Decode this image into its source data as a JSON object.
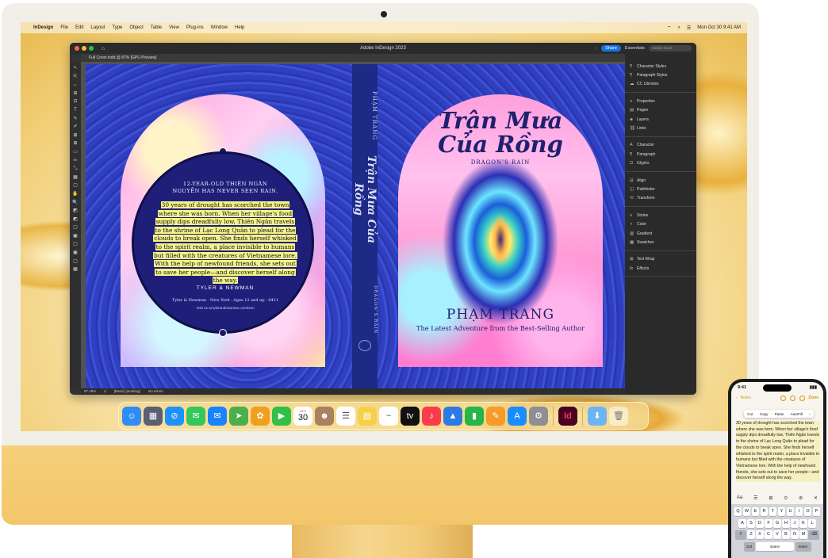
{
  "menubar": {
    "app": "InDesign",
    "items": [
      "File",
      "Edit",
      "Layout",
      "Type",
      "Object",
      "Table",
      "View",
      "Plug-ins",
      "Window",
      "Help"
    ],
    "clock": "Mon Oct 30  9:41 AM"
  },
  "window": {
    "title": "Adobe InDesign 2023",
    "share_label": "Share",
    "workspace_label": "Essentials",
    "search_placeholder": "Adobe Stock",
    "doc_tab": "Full Cover.indd @ 87% [GPU Preview]"
  },
  "tools": [
    "↖",
    "⇱",
    "↔",
    "⊞",
    "⊡",
    "T",
    "✎",
    "✐",
    "⊠",
    "⊠",
    "▭",
    "✂",
    "⤡",
    "▦",
    "▢",
    "✋",
    "🔍",
    "◩",
    "◩",
    "▢",
    "▣",
    "▢",
    "▣",
    "▢",
    "▦"
  ],
  "panels": {
    "groups": [
      [
        {
          "icon": "¶",
          "label": "Character Styles"
        },
        {
          "icon": "¶",
          "label": "Paragraph Styles"
        },
        {
          "icon": "☁",
          "label": "CC Libraries"
        }
      ],
      [
        {
          "icon": "≡",
          "label": "Properties"
        },
        {
          "icon": "▤",
          "label": "Pages"
        },
        {
          "icon": "◈",
          "label": "Layers"
        },
        {
          "icon": "⛓",
          "label": "Links"
        }
      ],
      [
        {
          "icon": "A",
          "label": "Character"
        },
        {
          "icon": "¶",
          "label": "Paragraph"
        },
        {
          "icon": "Ω",
          "label": "Glyphs"
        }
      ],
      [
        {
          "icon": "⊟",
          "label": "Align"
        },
        {
          "icon": "◫",
          "label": "Pathfinder"
        },
        {
          "icon": "⟲",
          "label": "Transform"
        }
      ],
      [
        {
          "icon": "≡",
          "label": "Stroke"
        },
        {
          "icon": "◑",
          "label": "Color"
        },
        {
          "icon": "▥",
          "label": "Gradient"
        },
        {
          "icon": "▦",
          "label": "Swatches"
        }
      ],
      [
        {
          "icon": "⊞",
          "label": "Text Wrap"
        },
        {
          "icon": "fx",
          "label": "Effects"
        }
      ]
    ]
  },
  "status": {
    "zoom": "87.19%",
    "page": "2",
    "style": "[Basic] (working)",
    "errors": "No errors"
  },
  "cover": {
    "back": {
      "tagline": "12-YEAR-OLD THIÊN NGÂN NGUYỄN HAS NEVER SEEN RAIN.",
      "blurb": "30 years of drought has scorched the town where she was born. When her village's food supply dips dreadfully low, Thiên Ngân travels to the shrine of Lạc Long Quân to plead for the clouds to break open. She finds herself whisked to the spirit realm, a place invisible to humans but filled with the creatures of Vietnamese lore. With the help of newfound friends, she sets out to save her people—and discover herself along the way.",
      "publisher_logo": "TYLER & NEWMAN",
      "publisher_line": "Tyler & Newman · New York · Ages 12 and up · 0411",
      "publisher_url": "Visit us at tylerandnewman.com/tson"
    },
    "spine": {
      "author": "PHẠM TRANG",
      "title": "Trận Mưa Của Rồng",
      "subtitle": "DRAGON'S RAIN"
    },
    "front": {
      "title_line1": "Trận Mưa",
      "title_line2": "Của Rồng",
      "subtitle": "DRAGON'S RAIN",
      "author": "PHẠM TRANG",
      "tagline": "The Latest Adventure from the Best-Selling Author"
    }
  },
  "dock": {
    "apps": [
      {
        "name": "finder",
        "glyph": "☺",
        "color": "#2f8cf5"
      },
      {
        "name": "launchpad",
        "glyph": "▦",
        "color": "#5b5f73"
      },
      {
        "name": "safari",
        "glyph": "⊘",
        "color": "#1e90ff"
      },
      {
        "name": "messages",
        "glyph": "✉",
        "color": "#34c759"
      },
      {
        "name": "mail",
        "glyph": "✉",
        "color": "#1a82fb"
      },
      {
        "name": "maps",
        "glyph": "➤",
        "color": "#4cae4c"
      },
      {
        "name": "photos",
        "glyph": "✿",
        "color": "#f0a020"
      },
      {
        "name": "facetime",
        "glyph": "▶",
        "color": "#30c04a"
      },
      {
        "name": "calendar",
        "glyph": "30",
        "color": "#ffffff"
      },
      {
        "name": "contacts",
        "glyph": "☻",
        "color": "#a98160"
      },
      {
        "name": "reminders",
        "glyph": "☰",
        "color": "#ffffff"
      },
      {
        "name": "notes",
        "glyph": "▤",
        "color": "#f6d04d"
      },
      {
        "name": "freeform",
        "glyph": "~",
        "color": "#ffffff"
      },
      {
        "name": "tv",
        "glyph": "tv",
        "color": "#111111"
      },
      {
        "name": "music",
        "glyph": "♪",
        "color": "#fa3c4c"
      },
      {
        "name": "keynote",
        "glyph": "▲",
        "color": "#2c7be5"
      },
      {
        "name": "numbers",
        "glyph": "▮",
        "color": "#28b446"
      },
      {
        "name": "pages",
        "glyph": "✎",
        "color": "#f59b2a"
      },
      {
        "name": "app-store",
        "glyph": "A",
        "color": "#1a8cff"
      },
      {
        "name": "system-settings",
        "glyph": "⚙",
        "color": "#8e8e93"
      }
    ],
    "calendar_month": "OCT",
    "calendar_day": "30",
    "indesign": "Id",
    "downloads_glyph": "⬇",
    "trash_glyph": "🗑"
  },
  "phone": {
    "time": "9:41",
    "back_label": "Notes",
    "done_label": "Done",
    "edit_menu": [
      "Cut",
      "Copy",
      "Paste",
      "AutoFill",
      "›"
    ],
    "note_text": "30 years of drought has scorched the town where she was born. When her village's food supply dips dreadfully low, Thiên Ngân travels to the shrine of Lạc Long Quân to plead for the clouds to break open. She finds herself whisked to the spirit realm, a place invisible to humans but filled with the creatures of Vietnamese lore. With the help of newfound friends, she sets out to save her people—and discover herself along the way.",
    "format_bar": [
      "Aa",
      "☰",
      "⊞",
      "⊙",
      "⊚",
      "✕"
    ],
    "keys_row1": [
      "Q",
      "W",
      "E",
      "R",
      "T",
      "Y",
      "U",
      "I",
      "O",
      "P"
    ],
    "keys_row2": [
      "A",
      "S",
      "D",
      "F",
      "G",
      "H",
      "J",
      "K",
      "L"
    ],
    "keys_row3": [
      "Z",
      "X",
      "C",
      "V",
      "B",
      "N",
      "M"
    ],
    "shift": "⇧",
    "delete": "⌫",
    "num_key": "123",
    "space_key": "space",
    "return_key": "return"
  }
}
